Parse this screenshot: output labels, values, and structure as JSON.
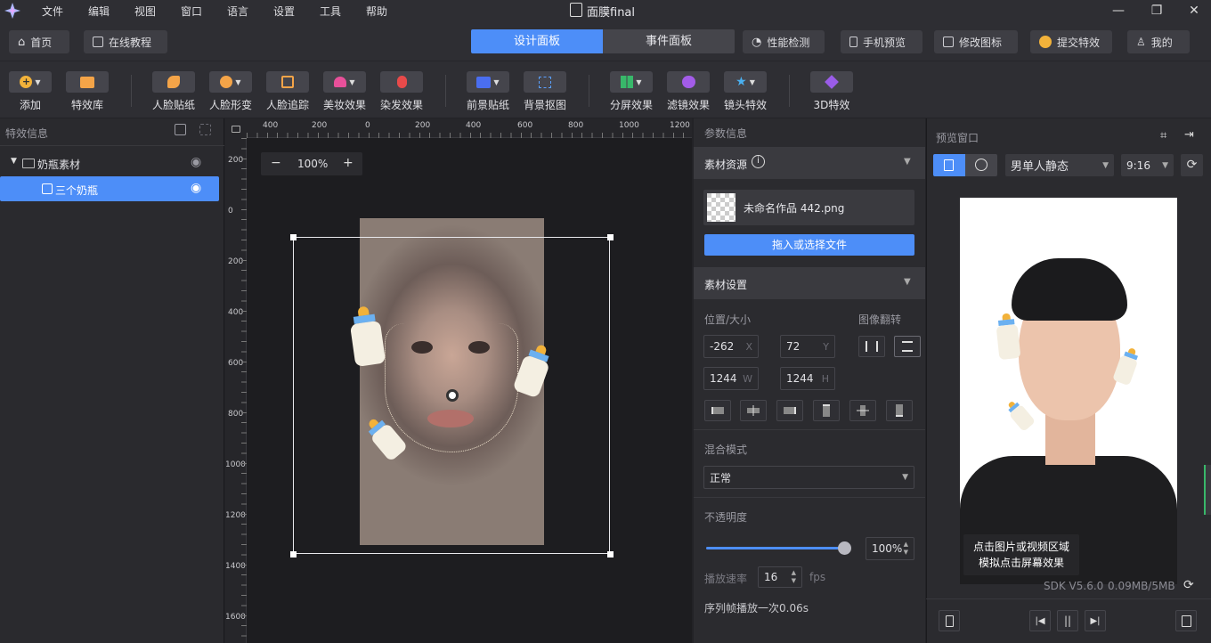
{
  "app": {
    "title": "面膜final"
  },
  "menu": [
    "文件",
    "编辑",
    "视图",
    "窗口",
    "语言",
    "设置",
    "工具",
    "帮助"
  ],
  "nav": {
    "home": "首页",
    "tutorial": "在线教程",
    "tab_design": "设计面板",
    "tab_event": "事件面板",
    "perf": "性能检测",
    "phone_preview": "手机预览",
    "edit_icon": "修改图标",
    "submit": "提交特效",
    "me": "我的"
  },
  "toolbar": {
    "add": "添加",
    "library": "特效库",
    "face_sticker": "人脸贴纸",
    "face_shape": "人脸形变",
    "face_track": "人脸追踪",
    "makeup": "美妆效果",
    "hair_dye": "染发效果",
    "fg_sticker": "前景贴纸",
    "bg_cutout": "背景抠图",
    "split": "分屏效果",
    "filter": "滤镜效果",
    "lens": "镜头特效",
    "fx3d": "3D特效"
  },
  "left": {
    "title": "特效信息",
    "group": "奶瓶素材",
    "item": "三个奶瓶"
  },
  "canvas": {
    "zoom": "100%",
    "ruler_top": [
      "400",
      "200",
      "0",
      "200",
      "400",
      "600",
      "800",
      "1000",
      "1200"
    ],
    "ruler_left": [
      "200",
      "0",
      "200",
      "400",
      "600",
      "800",
      "1000",
      "1200",
      "1400",
      "1600"
    ]
  },
  "params": {
    "title": "参数信息",
    "resource_section": "素材资源",
    "file_name": "未命名作品 442.png",
    "upload": "拖入或选择文件",
    "settings_section": "素材设置",
    "pos_size": "位置/大小",
    "flip": "图像翻转",
    "x": "-262",
    "x_u": "X",
    "y": "72",
    "y_u": "Y",
    "w": "1244",
    "w_u": "W",
    "h": "1244",
    "h_u": "H",
    "blend_label": "混合模式",
    "blend_value": "正常",
    "opacity_label": "不透明度",
    "opacity_value": "100%",
    "opacity_level": 1.0,
    "rate_label": "播放速率",
    "rate_value": "16",
    "rate_unit": "fps",
    "seq_info": "序列帧播放一次0.06s"
  },
  "preview": {
    "title": "预览窗口",
    "model": "男单人静态",
    "ratio": "9:16",
    "hint_1": "点击图片或视频区域",
    "hint_2": "模拟点击屏幕效果",
    "sdk": "SDK V5.6.0",
    "mem": "0.09MB/5MB"
  },
  "colors": {
    "accent": "#4d8ef8",
    "panel": "#2b2b2f"
  }
}
